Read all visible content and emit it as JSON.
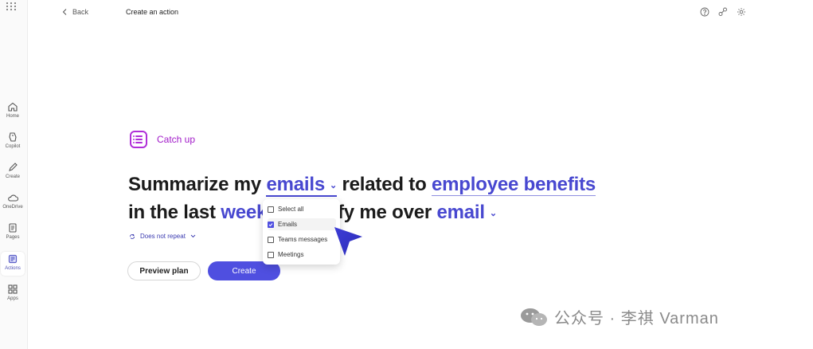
{
  "header": {
    "back_label": "Back",
    "title": "Create an action"
  },
  "rail": {
    "items": [
      {
        "label": "Home",
        "icon": "home-icon"
      },
      {
        "label": "Copilot",
        "icon": "copilot-icon"
      },
      {
        "label": "Create",
        "icon": "pen-icon"
      },
      {
        "label": "OneDrive",
        "icon": "cloud-icon"
      },
      {
        "label": "Pages",
        "icon": "pages-icon"
      },
      {
        "label": "Actions",
        "icon": "actions-icon",
        "active": true
      },
      {
        "label": "Apps",
        "icon": "apps-icon"
      }
    ]
  },
  "card": {
    "template_name": "Catch up"
  },
  "prompt": {
    "part1": "Summarize my ",
    "source_value": "emails",
    "part2": " related to ",
    "topic_value": "employee benefits",
    "part3": "in the last ",
    "period_value": "week",
    "part4": "otify me over ",
    "channel_value": "email"
  },
  "repeat": {
    "label": "Does not repeat"
  },
  "buttons": {
    "preview": "Preview plan",
    "create": "Create"
  },
  "dropdown": {
    "options": [
      {
        "label": "Select all",
        "checked": false
      },
      {
        "label": "Emails",
        "checked": true
      },
      {
        "label": "Teams messages",
        "checked": false
      },
      {
        "label": "Meetings",
        "checked": false
      }
    ]
  },
  "watermark": {
    "text": "公众号 · 李祺 Varman"
  },
  "colors": {
    "accent": "#4f4fe0",
    "catchup": "#b02fd8",
    "link": "#4848d0"
  }
}
